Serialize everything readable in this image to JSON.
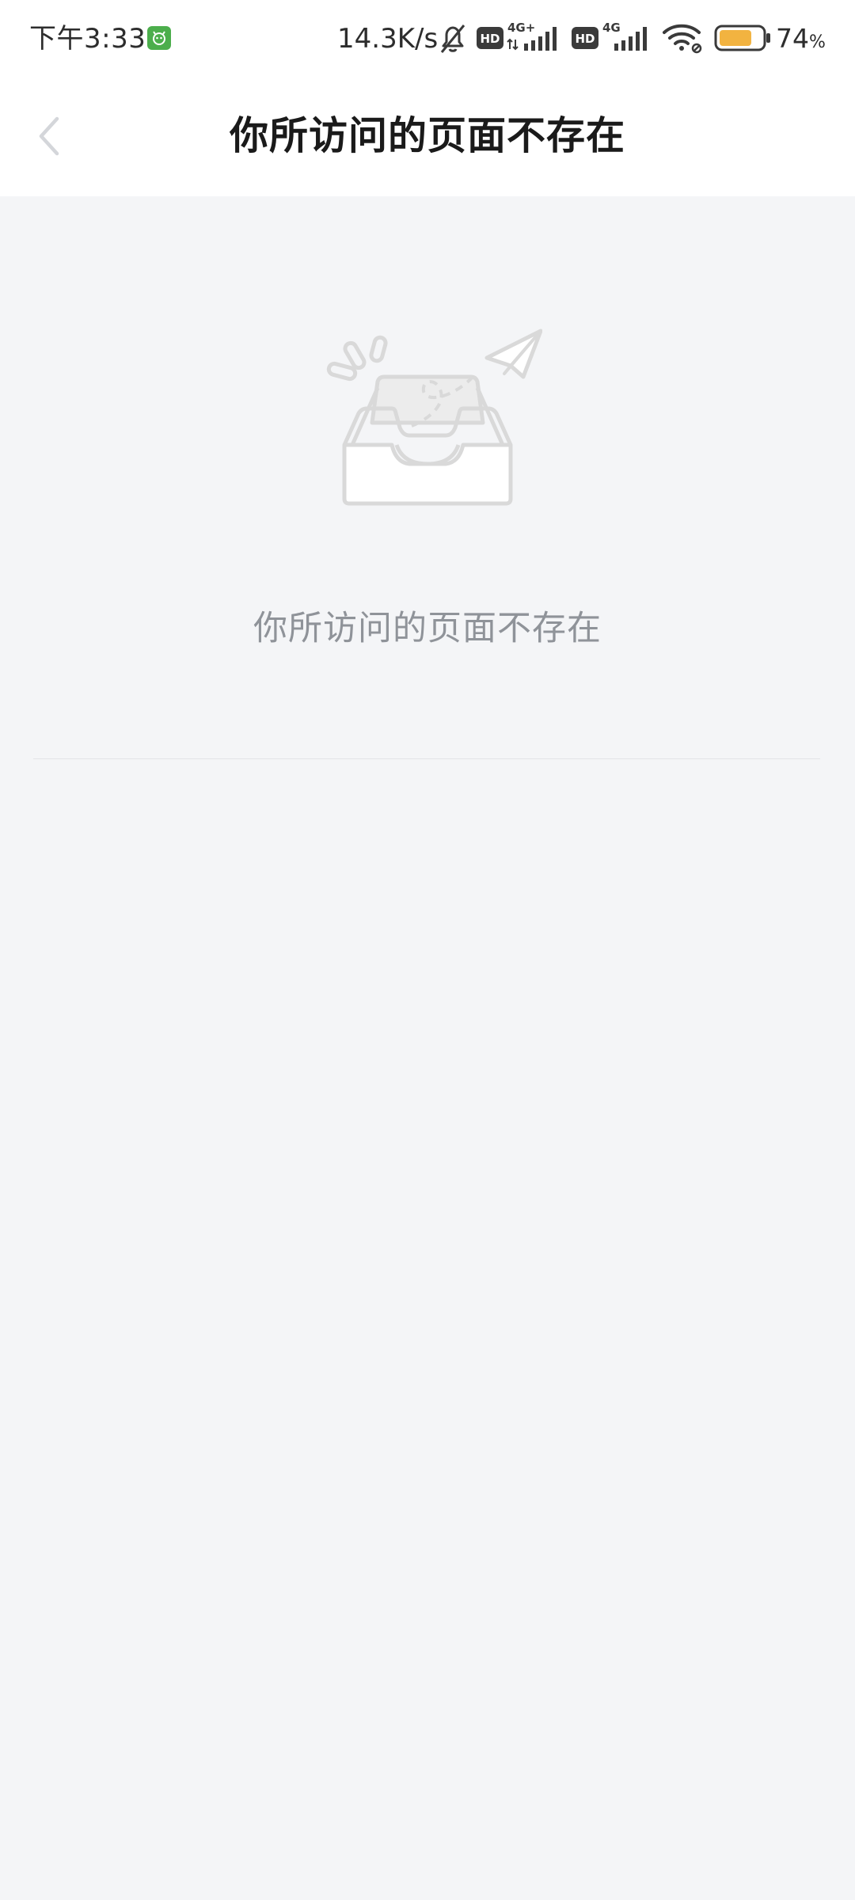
{
  "status_bar": {
    "time": "下午3:33",
    "app_badge_icon": "green-app-notification-icon",
    "network_speed": "14.3K/s",
    "sim1_tech": "4G+",
    "sim2_tech": "4G",
    "hd_label": "HD",
    "battery_level": "74",
    "battery_unit": "%",
    "battery_fraction": 0.74,
    "battery_color": "#f2b340"
  },
  "title_bar": {
    "title": "你所访问的页面不存在",
    "back_icon": "chevron-left-icon"
  },
  "empty_state": {
    "illustration_icon": "empty-inbox-paper-plane-icon",
    "message": "你所访问的页面不存在"
  },
  "colors": {
    "page_background": "#f4f5f7",
    "title_color": "#1a1a1a",
    "message_color": "#8f9399",
    "illustration_stroke": "#d9d9d9"
  }
}
